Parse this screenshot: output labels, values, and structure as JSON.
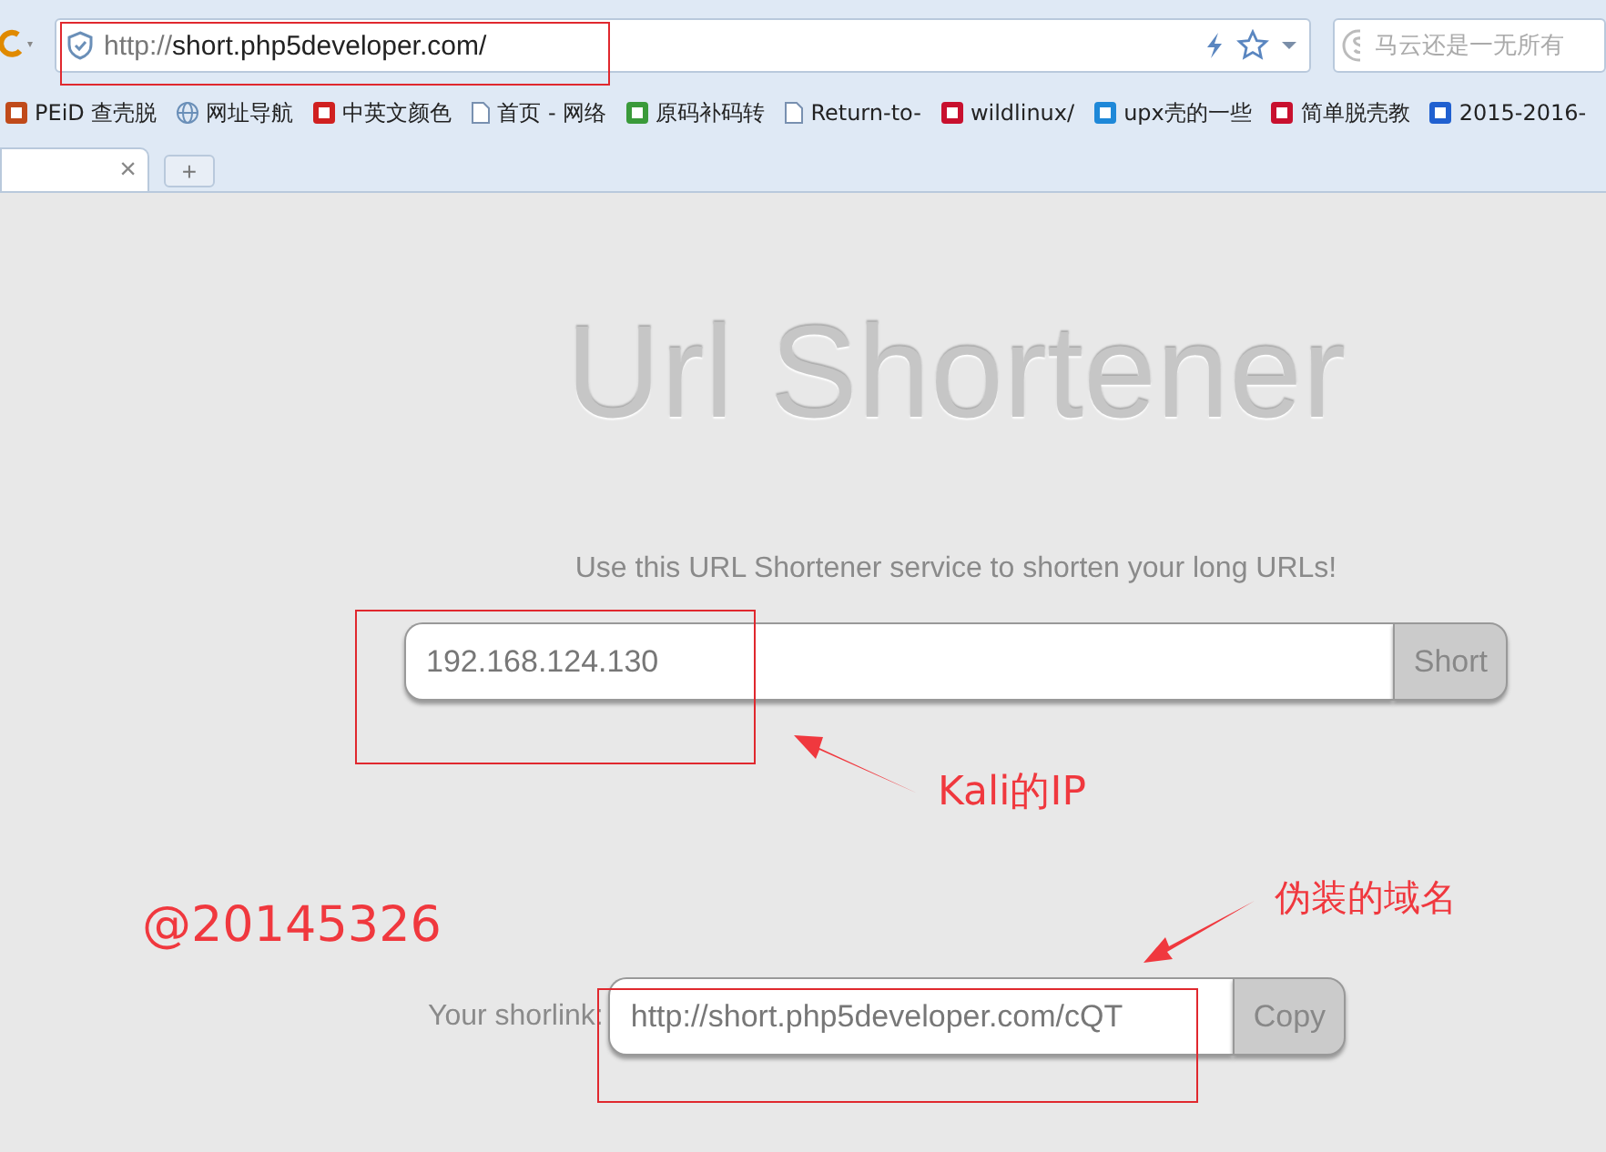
{
  "address_bar": {
    "url_prefix": "http://",
    "url_host": "short.php5developer.com/"
  },
  "search_box": {
    "placeholder": "马云还是一无所有"
  },
  "bookmarks": [
    {
      "label": "PEiD 查壳脱",
      "kind": "logo",
      "color": "#c04a1a"
    },
    {
      "label": "网址导航",
      "kind": "globe"
    },
    {
      "label": "中英文颜色",
      "kind": "logo",
      "color": "#d02020"
    },
    {
      "label": "首页 - 网络",
      "kind": "page"
    },
    {
      "label": "原码补码转",
      "kind": "logo",
      "color": "#3a9a3a"
    },
    {
      "label": "Return-to-",
      "kind": "page"
    },
    {
      "label": "wildlinux/",
      "kind": "logo",
      "color": "#c8102e"
    },
    {
      "label": "upx壳的一些",
      "kind": "logo",
      "color": "#1e88d8"
    },
    {
      "label": "简单脱壳教",
      "kind": "logo",
      "color": "#c8102e"
    },
    {
      "label": "2015-2016-",
      "kind": "logo",
      "color": "#2060d0"
    }
  ],
  "tabs": [
    {
      "close": "×",
      "selected": true
    }
  ],
  "new_tab": "+",
  "page": {
    "title": "Url Shortener",
    "description": "Use this URL Shortener service to shorten your long URLs!",
    "url_input": {
      "value": "192.168.124.130"
    },
    "short_button": "Short",
    "shortlink_label": "Your shorlink:",
    "shortlink": {
      "value": "http://short.php5developer.com/cQT"
    },
    "copy_button": "Copy"
  },
  "annotations": {
    "ip_note": "Kali的IP",
    "domain_note": "伪装的域名",
    "author": "@20145326"
  }
}
